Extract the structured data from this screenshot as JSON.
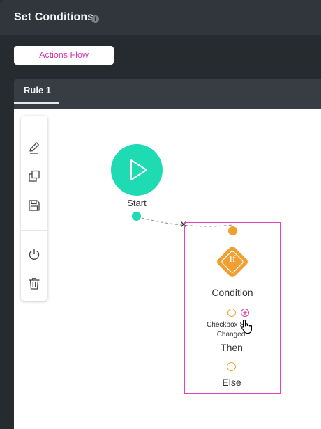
{
  "header": {
    "title": "Set Conditions",
    "info_icon": "info-icon"
  },
  "tabs": {
    "actions_flow_label": "Actions Flow"
  },
  "rule": {
    "tab_label": "Rule 1"
  },
  "toolbar": {
    "items": [
      "pencil-icon",
      "copy-icon",
      "save-icon",
      "power-icon",
      "trash-icon"
    ]
  },
  "nodes": {
    "start": {
      "label": "Start"
    },
    "condition": {
      "label": "Condition",
      "icon_text": "If",
      "event_label_line1": "Checkbox S",
      "event_label_line2": "Changed",
      "then_label": "Then",
      "else_label": "Else"
    }
  },
  "colors": {
    "accent_pink": "#e23fb8",
    "start_teal": "#1fdbb3",
    "condition_orange": "#f0a032",
    "header_bg": "#30363c"
  }
}
